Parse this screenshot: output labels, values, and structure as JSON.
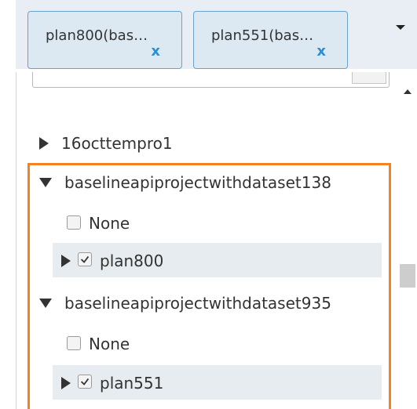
{
  "selected_chips": [
    {
      "label": "plan800(bas…",
      "remove_label": "x"
    },
    {
      "label": "plan551(bas…",
      "remove_label": "x"
    }
  ],
  "tree": {
    "items": [
      {
        "label": "16octtempro1",
        "expanded": false
      },
      {
        "label": "baselineapiprojectwithdataset138",
        "expanded": true,
        "children": [
          {
            "label": "None",
            "checked": false
          },
          {
            "label": "plan800",
            "checked": true,
            "expandable": true
          }
        ]
      },
      {
        "label": "baselineapiprojectwithdataset935",
        "expanded": true,
        "children": [
          {
            "label": "None",
            "checked": false
          },
          {
            "label": "plan551",
            "checked": true,
            "expandable": true
          }
        ]
      }
    ]
  },
  "colors": {
    "highlight": "#f58220",
    "chip_border": "#6aa3c9",
    "chip_remove": "#2b8fd6",
    "row_selected": "#e6ecef"
  },
  "icons": [
    "triangle-right-icon",
    "triangle-down-icon",
    "checkbox-icon",
    "caret-down-icon",
    "arrow-up-icon"
  ]
}
